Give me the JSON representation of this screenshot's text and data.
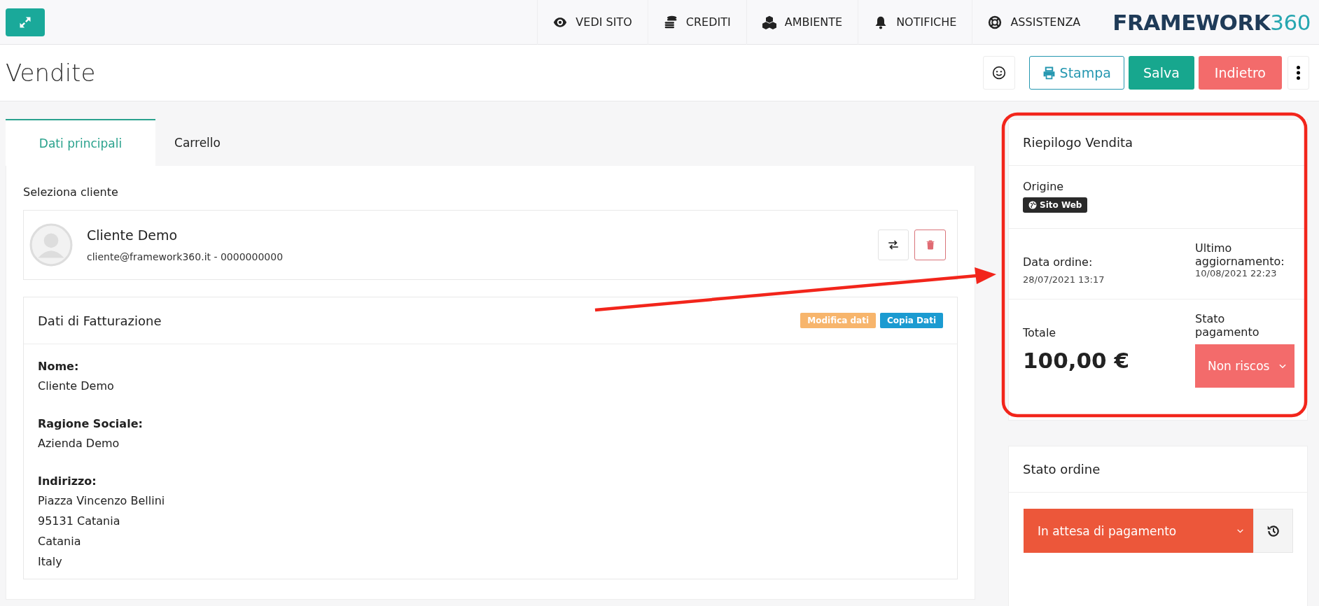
{
  "topbar": {
    "nav": [
      {
        "label": "VEDI SITO"
      },
      {
        "label": "CREDITI"
      },
      {
        "label": "AMBIENTE"
      },
      {
        "label": "NOTIFICHE"
      },
      {
        "label": "ASSISTENZA"
      }
    ],
    "logo": {
      "text": "FRAMEWORK",
      "accent": "360"
    }
  },
  "header": {
    "title": "Vendite",
    "buttons": [
      {
        "kind": "smiley"
      },
      {
        "kind": "print",
        "label": "Stampa"
      },
      {
        "kind": "primary",
        "label": "Salva"
      },
      {
        "kind": "danger",
        "label": "Indietro"
      },
      {
        "kind": "more"
      }
    ]
  },
  "tabs": [
    {
      "label": "Dati principali",
      "selected": true
    },
    {
      "label": "Carrello",
      "selected": false
    }
  ],
  "customer": {
    "section_label": "Seleziona cliente",
    "name": "Cliente Demo",
    "contact": "cliente@framework360.it - 0000000000"
  },
  "billing": {
    "title": "Dati di Fatturazione",
    "actions": [
      {
        "label": "Modifica dati",
        "color": "#f7b56c"
      },
      {
        "label": "Copia Dati",
        "color": "#1b9bd1"
      }
    ],
    "fields": [
      {
        "label": "Nome:",
        "lines": [
          "Cliente Demo"
        ]
      },
      {
        "label": "Ragione Sociale:",
        "lines": [
          "Azienda Demo"
        ]
      },
      {
        "label": "Indirizzo:",
        "lines": [
          "Piazza Vincenzo Bellini",
          "95131 Catania",
          "Catania",
          "Italy"
        ]
      }
    ]
  },
  "summary": {
    "title": "Riepilogo Vendita",
    "origin_label": "Origine",
    "origin_badge": "Sito Web",
    "order_date_label": "Data ordine:",
    "order_date": "28/07/2021 13:17",
    "updated_label": "Ultimo aggiornamento:",
    "updated": "10/08/2021 22:23",
    "total_label": "Totale",
    "total": "100,00 €",
    "payment_label": "Stato pagamento",
    "payment_status": "Non riscos"
  },
  "order_status": {
    "title": "Stato ordine",
    "status": "In attesa di pagamento"
  }
}
